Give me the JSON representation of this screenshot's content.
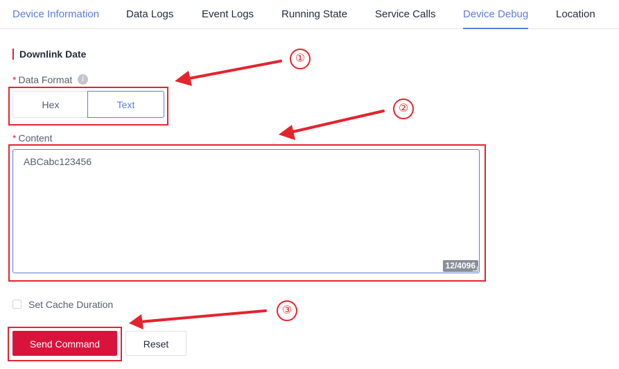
{
  "tabs": [
    {
      "label": "Device Information"
    },
    {
      "label": "Data Logs"
    },
    {
      "label": "Event Logs"
    },
    {
      "label": "Running State"
    },
    {
      "label": "Service Calls"
    },
    {
      "label": "Device Debug"
    },
    {
      "label": "Location"
    }
  ],
  "section": {
    "title": "Downlink Date"
  },
  "data_format": {
    "label": "Data Format",
    "required_mark": "*",
    "info_icon": "info-icon",
    "options": [
      {
        "label": "Hex"
      },
      {
        "label": "Text"
      }
    ],
    "selected": "Text"
  },
  "content": {
    "label": "Content",
    "required_mark": "*",
    "value": "ABCabc123456",
    "counter": "12/4096"
  },
  "cache": {
    "label": "Set Cache Duration",
    "checked": false
  },
  "buttons": {
    "send": "Send Command",
    "reset": "Reset"
  },
  "annotations": [
    {
      "number": "①"
    },
    {
      "number": "②"
    },
    {
      "number": "③"
    }
  ],
  "colors": {
    "accent": "#5e7ce0",
    "danger": "#d9143c",
    "annotation": "#e5232d"
  }
}
